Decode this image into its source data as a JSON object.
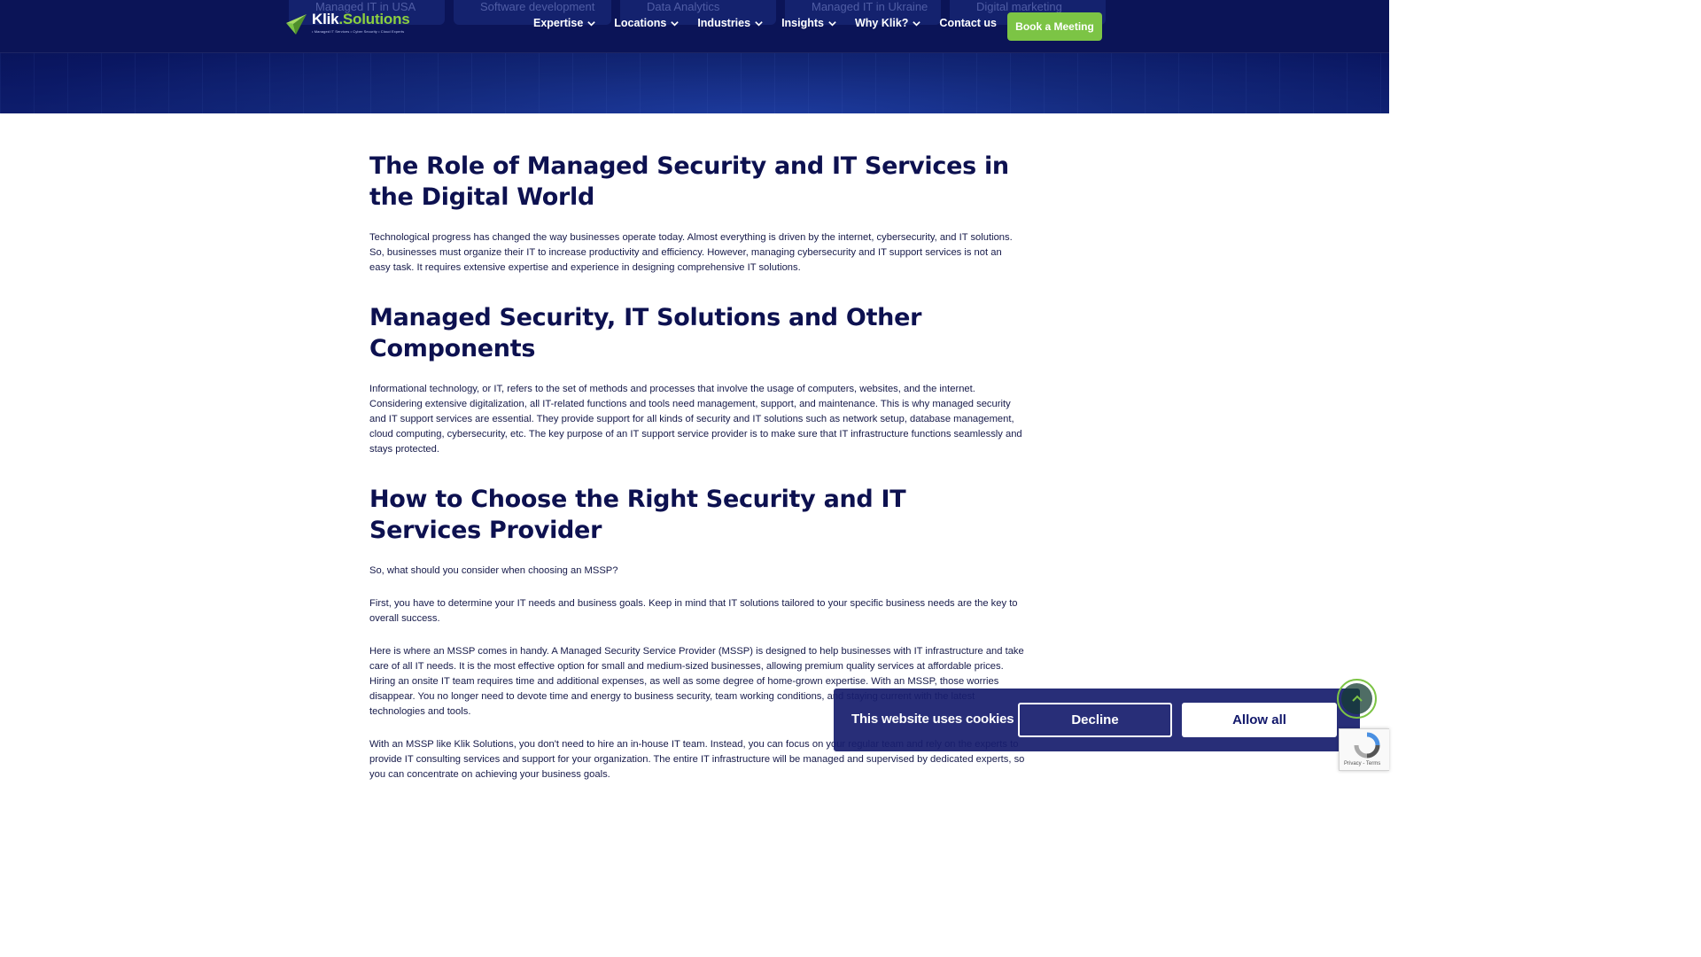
{
  "header": {
    "ghost_tabs": [
      "Managed IT in USA",
      "Software development",
      "Data Analytics",
      "Managed IT in Ukraine",
      "Digital marketing"
    ],
    "logo": {
      "name_main": "Klik",
      "name_accent": ".Solutions",
      "tagline": "• Managed IT Services • Cyber Security • Cloud Experts"
    },
    "nav": [
      {
        "label": "Expertise",
        "has_dropdown": true
      },
      {
        "label": "Locations",
        "has_dropdown": true
      },
      {
        "label": "Industries",
        "has_dropdown": true
      },
      {
        "label": "Insights",
        "has_dropdown": true
      },
      {
        "label": "Why Klik?",
        "has_dropdown": true
      },
      {
        "label": "Contact us",
        "has_dropdown": false
      }
    ],
    "cta_label": "Book a Meeting",
    "colors": {
      "navy": "#0b1457",
      "green": "#7cc445"
    }
  },
  "article": {
    "sections": [
      {
        "heading": "The Role of Managed Security and IT Services in the Digital World",
        "paragraphs": [
          "Technological progress has changed the way businesses operate today. Almost everything is driven by the internet, cybersecurity, and IT solutions. So, businesses must organize their IT to increase productivity and efficiency. However, managing cybersecurity and IT support services is not an easy task. It requires extensive expertise and experience in designing comprehensive IT solutions."
        ]
      },
      {
        "heading": "Managed Security, IT Solutions and Other Components",
        "paragraphs": [
          "Informational technology, or IT, refers to the set of methods and processes that involve the usage of computers, websites, and the internet. Considering extensive digitalization, all IT-related functions and tools need management, support, and maintenance. This is why managed security and IT support services are essential. They provide support for all kinds of security and IT solutions such as network setup, database management, cloud computing, cybersecurity, etc. The key purpose of an IT support service provider is to make sure that IT infrastructure functions seamlessly and stays protected."
        ]
      },
      {
        "heading": "How to Choose the Right Security and IT Services Provider",
        "paragraphs": [
          "So, what should you consider when choosing an MSSP?",
          "First, you have to determine your IT needs and business goals. Keep in mind that IT solutions tailored to your specific business needs are the key to overall success.",
          "Here is where an MSSP comes in handy. A Managed Security Service Provider (MSSP) is designed to help businesses with IT infrastructure and take care of all IT needs. It is the most effective option for small and medium-sized businesses, allowing premium quality services at affordable prices. Hiring an onsite IT team requires time and additional expenses, as well as some degree of home-grown expertise. With an MSSP, those worries disappear. You no longer need to devote time and energy to business security, team working conditions, and staying current with the latest technologies and tools.",
          "With an MSSP like Klik Solutions, you don't need to hire an in-house IT team. Instead, you can focus on your regular team and rely on the experts to provide IT consulting services and support for your organization. The entire IT infrastructure will be managed and supervised by dedicated experts, so you can concentrate on achieving your business goals."
        ]
      }
    ]
  },
  "cookie_banner": {
    "message": "This website uses cookies",
    "decline_label": "Decline",
    "allow_label": "Allow all"
  },
  "recaptcha": {
    "links": "Privacy - Terms"
  },
  "icons": [
    "klik-logo-icon",
    "chevron-down-icon",
    "arrow-up-icon",
    "recaptcha-icon"
  ]
}
